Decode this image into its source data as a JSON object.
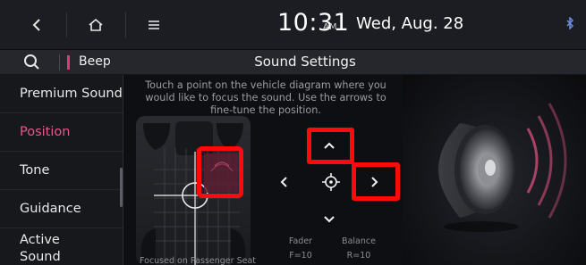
{
  "topbar": {
    "back_icon": "chevron-left-icon",
    "home_icon": "home-icon",
    "menu_icon": "menu-icon",
    "time": "10:31",
    "ampm": "AM",
    "date": "Wed, Aug. 28",
    "bluetooth_icon": "bluetooth-icon"
  },
  "subbar": {
    "search_icon": "search-icon",
    "beep_label": "Beep",
    "title": "Sound Settings",
    "accent_color": "#e0397a"
  },
  "sidebar": {
    "items": [
      {
        "label": "Premium Sound"
      },
      {
        "label": "Position"
      },
      {
        "label": "Tone"
      },
      {
        "label": "Guidance"
      },
      {
        "label": "Active Sound Design"
      }
    ],
    "active_index": 1,
    "active_color": "#e05b8c"
  },
  "main": {
    "instruction": "Touch a point on the vehicle diagram where you would like to focus the sound. Use the arrows to fine-tune the position.",
    "focus_status": "Focused on Passenger Seat",
    "fader_label": "Fader",
    "fader_value": "F=10",
    "balance_label": "Balance",
    "balance_value": "R=10",
    "controls": [
      "up-arrow",
      "down-arrow",
      "left-arrow",
      "right-arrow",
      "center-target"
    ],
    "highlight_color": "#ff0a0a"
  },
  "right_panel": {
    "graphic": "speaker-icon"
  }
}
